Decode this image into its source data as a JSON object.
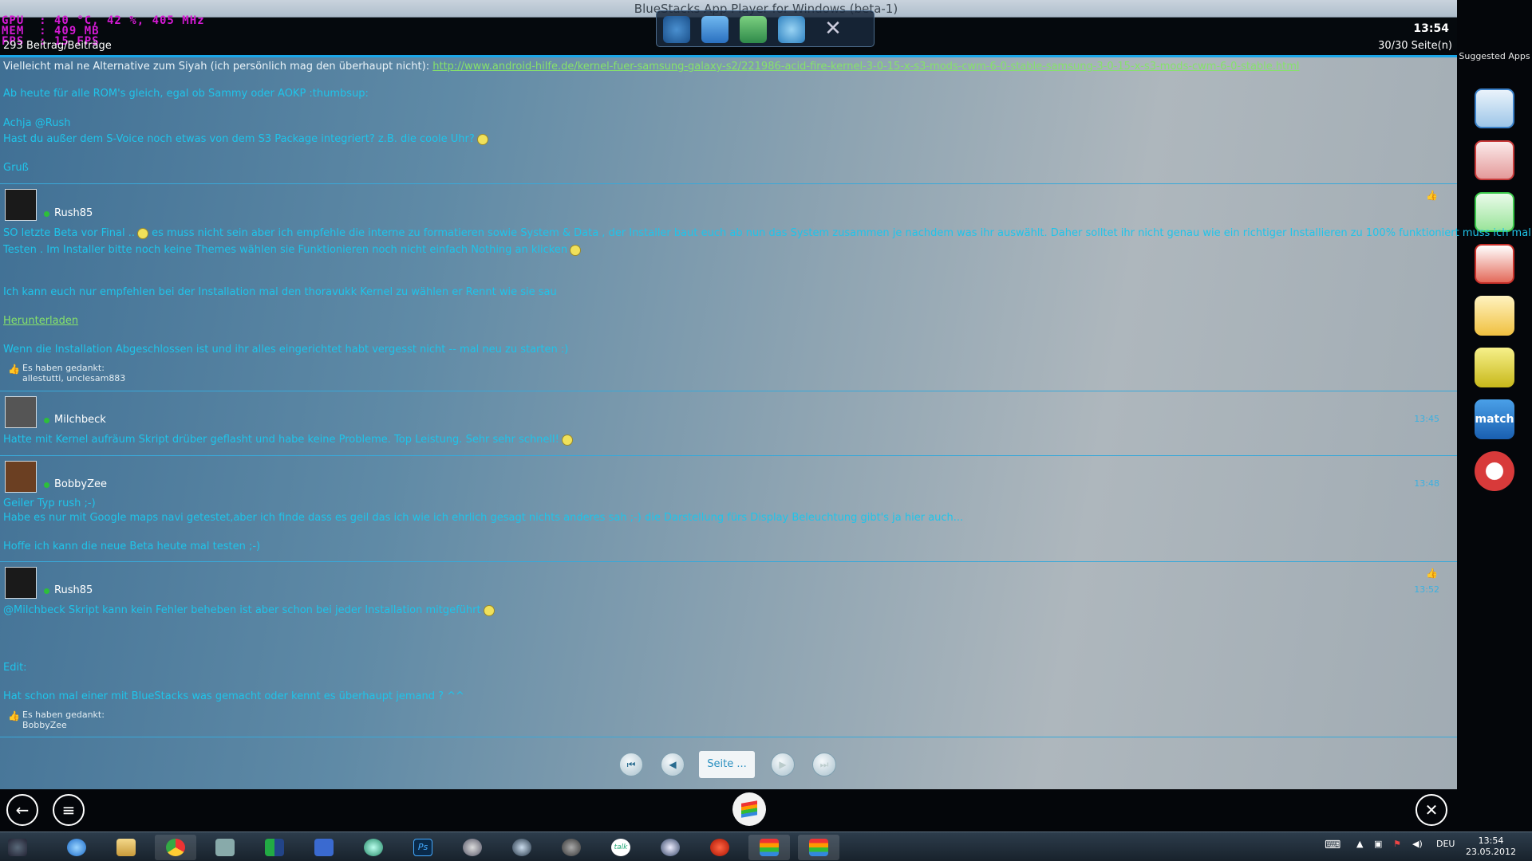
{
  "window": {
    "title": "BlueStacks App Player for Windows (beta-1)"
  },
  "hud": {
    "gpu": "GPU  : 40 °C, 42 %, 405 MHz",
    "mem": "MEM  : 409 MB",
    "fps": "FPS  : 15 FPS"
  },
  "status": {
    "post_count": "293 Beitrag/Beiträge",
    "time": "13:54",
    "pages": "30/30 Seite(n)"
  },
  "sidebar": {
    "title": "Suggested Apps",
    "apps": [
      "App 1",
      "App 2",
      "App 3",
      "App 4",
      "App 5",
      "App 6",
      "match",
      "App 8"
    ]
  },
  "post1": {
    "line1_text": "Vielleicht mal ne Alternative zum Siyah (ich persönlich mag den überhaupt nicht):",
    "line1_link": "http://www.android-hilfe.de/kernel-fuer-samsung-galaxy-s2/221986-acid-fire-kernel-3-0-15-x-s3-mods-cwm-6-0-stable-samsung-3-0-15-x-s3-mods-cwm-6-0-stable.html",
    "line2": "Ab heute für alle ROM's gleich, egal ob Sammy oder AOKP :thumbsup:",
    "line3": "Achja @Rush",
    "line4": "Hast du außer dem S-Voice noch etwas von dem S3 Package integriert? z.B. die coole Uhr?",
    "line5": "Gruß"
  },
  "post2": {
    "user": "Rush85",
    "line1a": "SO letzte Beta vor Final ..",
    "line1b": "es muss nicht sein aber ich empfehle die interne zu formatieren sowie System & Data , der Installer baut euch ab nun das System zusammen je nachdem was ihr auswählt. Daher solltet ihr nicht genau wie ein richtiger Installieren zu 100% funktioniert muss ich mal",
    "line2": "Testen . Im Installer bitte noch keine Themes wählen sie Funktionieren noch nicht einfach Nothing an klicken",
    "line3": "Ich kann euch nur empfehlen bei der Installation mal den thoravukk Kernel zu wählen er Rennt wie sie sau",
    "link": "Herunterladen",
    "line4": "Wenn die Installation Abgeschlossen ist und ihr alles eingerichtet habt vergesst nicht -- mal neu zu starten :)",
    "thanks_label": "Es haben gedankt:",
    "thanks_users": "allestutti, unclesam883"
  },
  "post3": {
    "user": "Milchbeck",
    "line1": "Hatte mit Kernel aufräum Skript drüber geflasht und habe keine Probleme. Top Leistung. Sehr sehr schnell!",
    "time": "13:45"
  },
  "post4": {
    "user": "BobbyZee",
    "line1": "Geiler Typ rush ;-)",
    "line2": "Habe es nur mit Google maps navi getestet,aber ich finde dass es geil das ich wie ich ehrlich gesagt nichts anderes sah ;-) die Darstellung fürs Display Beleuchtung gibt's ja hier auch...",
    "line3": "Hoffe ich kann die neue Beta heute mal testen ;-)",
    "time": "13:48"
  },
  "post5": {
    "user": "Rush85",
    "line1": "@Milchbeck Skript kann kein Fehler beheben ist aber schon bei jeder Installation mitgeführt",
    "line2": "Edit:",
    "line3": "Hat schon mal einer mit BlueStacks was gemacht oder kennt es überhaupt jemand ? ^^",
    "thanks_label": "Es haben gedankt:",
    "thanks_users": "BobbyZee",
    "time": "13:52"
  },
  "pager": {
    "first": "⏮",
    "prev": "◀",
    "page_button": "Seite ...",
    "next": "▶",
    "last": "⏭"
  },
  "taskbar": {
    "lang": "DEU",
    "time": "13:54",
    "date": "23.05.2012",
    "talk": "talk"
  },
  "colors": {
    "accent": "#1aa6e8",
    "link_green": "#86e26a",
    "cyan_text": "#1fc4ea",
    "hud_magenta": "#d41ad4"
  }
}
